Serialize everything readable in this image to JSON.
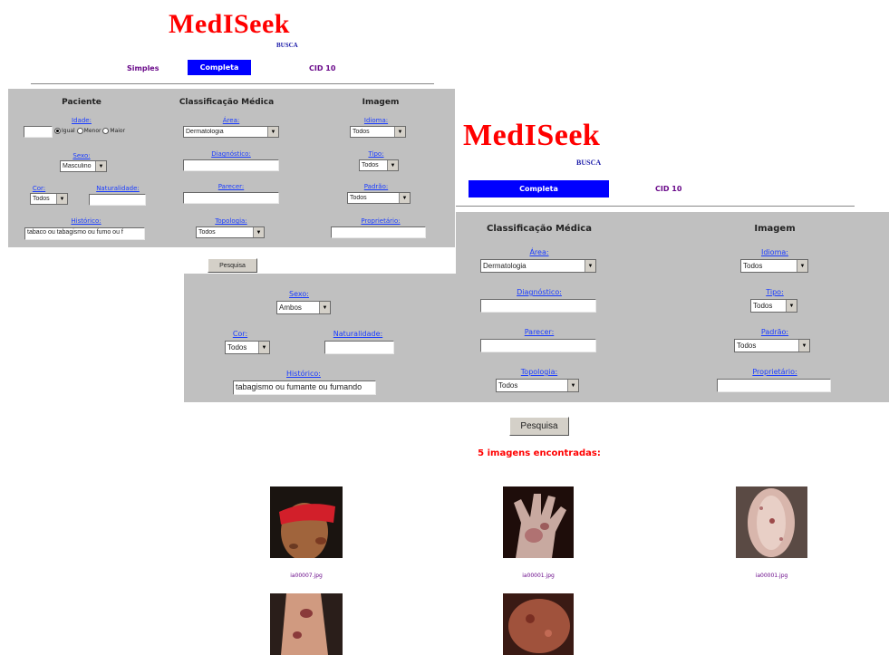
{
  "colors": {
    "logo": "#ff0000",
    "nav_active": "#0000ff",
    "panel": "#c0c0c0",
    "label": "#1a3cff",
    "results": "#ff0000"
  },
  "front": {
    "logo": "MedISeek",
    "busca": "BUSCA",
    "nav": {
      "simples": "Simples",
      "completa": "Completa",
      "cid10": "CID 10"
    },
    "sections": {
      "paciente": "Paciente",
      "classificacao": "Classificação Médica",
      "imagem": "Imagem"
    },
    "idade": {
      "label": "Idade:",
      "value": "",
      "options": [
        "Igual",
        "Menor",
        "Maior"
      ]
    },
    "sexo": {
      "label": "Sexo:",
      "value": "Masculino"
    },
    "cor": {
      "label": "Cor:",
      "value": "Todos"
    },
    "naturalidade": {
      "label": "Naturalidade:",
      "value": ""
    },
    "historico": {
      "label": "Histórico:",
      "value": "tabaco ou tabagismo ou fumo ou f"
    },
    "area": {
      "label": "Área:",
      "value": "Dermatologia"
    },
    "diagnostico": {
      "label": "Diagnóstico:",
      "value": ""
    },
    "parecer": {
      "label": "Parecer:",
      "value": ""
    },
    "topologia": {
      "label": "Topologia:",
      "value": "Todos"
    },
    "idioma": {
      "label": "Idioma:",
      "value": "Todos"
    },
    "tipo": {
      "label": "Tipo:",
      "value": "Todos"
    },
    "padrao": {
      "label": "Padrão:",
      "value": "Todos"
    },
    "proprietario": {
      "label": "Proprietário:",
      "value": ""
    },
    "pesquisa": "Pesquisa"
  },
  "back": {
    "logo": "MedISeek",
    "busca": "BUSCA",
    "nav": {
      "completa": "Completa",
      "cid10": "CID 10"
    },
    "sections": {
      "classificacao": "Classificação Médica",
      "imagem": "Imagem"
    },
    "sexo": {
      "label": "Sexo:",
      "value": "Ambos"
    },
    "cor": {
      "label": "Cor:",
      "value": "Todos"
    },
    "naturalidade": {
      "label": "Naturalidade:",
      "value": ""
    },
    "historico": {
      "label": "Histórico:",
      "value": "tabagismo ou fumante ou fumando"
    },
    "area": {
      "label": "Área:",
      "value": "Dermatologia"
    },
    "diagnostico": {
      "label": "Diagnóstico:",
      "value": ""
    },
    "parecer": {
      "label": "Parecer:",
      "value": ""
    },
    "topologia": {
      "label": "Topologia:",
      "value": "Todos"
    },
    "idioma": {
      "label": "Idioma:",
      "value": "Todos"
    },
    "tipo": {
      "label": "Tipo:",
      "value": "Todos"
    },
    "padrao": {
      "label": "Padrão:",
      "value": "Todos"
    },
    "proprietario": {
      "label": "Proprietário:",
      "value": ""
    },
    "pesquisa": "Pesquisa",
    "results": "5 imagens encontradas:",
    "images": [
      {
        "name": "ia00007.jpg"
      },
      {
        "name": "ia00001.jpg"
      },
      {
        "name": "ia00001.jpg"
      },
      {
        "name": ""
      },
      {
        "name": ""
      }
    ]
  }
}
